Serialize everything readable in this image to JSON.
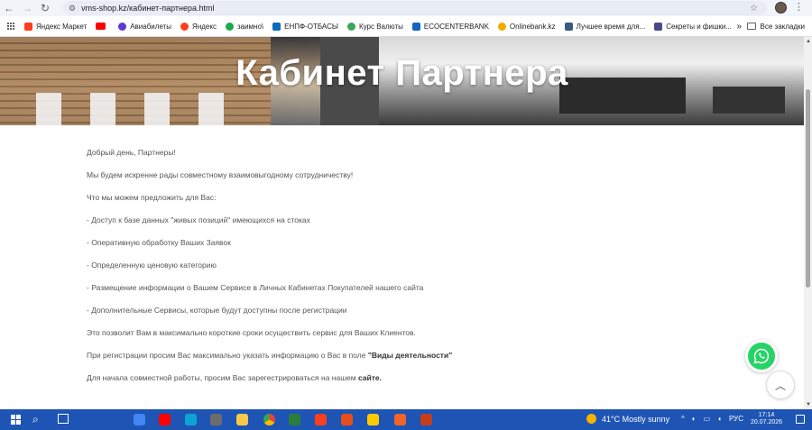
{
  "browser": {
    "url": "vms-shop.kz/кабинет-партнера.html",
    "bookmarks": [
      {
        "label": "Яндекс Маркет",
        "color": "#fc3f1d"
      },
      {
        "label": "",
        "color": "#ff0000"
      },
      {
        "label": "Авиабилеты",
        "color": "#5e3bd0"
      },
      {
        "label": "Яндекс",
        "color": "#fc3f1d"
      },
      {
        "label": "заимно\\",
        "color": "#1ba84f"
      },
      {
        "label": "ЕНПФ-ОТБАСЫ",
        "color": "#0b6bb8"
      },
      {
        "label": "Курс Валюты",
        "color": "#3aa657"
      },
      {
        "label": "ECOCENTERBANK",
        "color": "#1565c0"
      },
      {
        "label": "Onlinebank.kz",
        "color": "#f2a900"
      },
      {
        "label": "Лучшее время для...",
        "color": "#3d5a80"
      },
      {
        "label": "Секреты и фишки...",
        "color": "#4a4a8a"
      }
    ],
    "bookmarks_more": "»",
    "all_bookmarks": "Все закладки"
  },
  "hero": {
    "title": "Кабинет Партнера"
  },
  "content": {
    "greeting": "Добрый день, Партнеры!",
    "intro": "Мы будем искренне рады совместному взаимовыгодному сотрудничеству!",
    "offer_heading": "Что мы можем предложить для Вас:",
    "items": [
      "- Доступ к базе данных \"живых позиций\" имеющихся на стоках",
      "- Оперативную обработку Ваших Заявок",
      "- Определенную ценовую категорию",
      "- Размещение информации о Вашем Сервисе в Личных Кабинетах Покупателей нашего сайта",
      "- Дополнительные Сервисы, которые будут доступны после регистрации"
    ],
    "benefit": "Это позволит Вам в максимально короткие сроки осуществить сервис для Ваших Клиентов.",
    "reg_note_prefix": "При регистрации просим Вас максимально указать информацию о Вас в поле ",
    "reg_note_field": "\"Виды деятельности\"",
    "start_prefix": "Для начала совместной работы, просим Вас зарегестрироваться на нашем ",
    "start_link": "сайте."
  },
  "taskbar": {
    "weather": "41°C  Mostly sunny",
    "lang": "РУС",
    "time": "17:14",
    "date": "20.07.2026",
    "apps": [
      {
        "name": "chrome-app",
        "color": "#4285f4"
      },
      {
        "name": "youtube-app",
        "color": "#ff0000"
      },
      {
        "name": "edge-app",
        "color": "#0fa3d3"
      },
      {
        "name": "calculator-app",
        "color": "#6d6d6d"
      },
      {
        "name": "explorer-app",
        "color": "#f7c948"
      },
      {
        "name": "chrome-active-app",
        "color": "#34a853"
      },
      {
        "name": "store-app",
        "color": "#2a7d3a"
      },
      {
        "name": "yandex-app",
        "color": "#fc3f1d"
      },
      {
        "name": "people-app",
        "color": "#e94e1b"
      },
      {
        "name": "yandex-browser-app",
        "color": "#ffcc00"
      },
      {
        "name": "feed-app",
        "color": "#f06529"
      },
      {
        "name": "powerpoint-app",
        "color": "#c43e1c"
      }
    ]
  }
}
